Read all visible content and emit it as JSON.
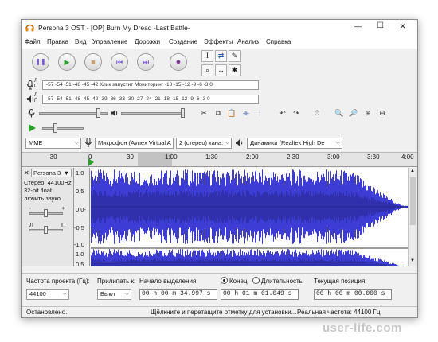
{
  "window": {
    "title": "Persona 3 OST - [OP] Burn My Dread -Last Battle-",
    "controls": {
      "minimize": "—",
      "maximize": "☐",
      "close": "✕"
    }
  },
  "menu": [
    "Файл",
    "Правка",
    "Вид",
    "Управление",
    "Дорожки",
    "Создание",
    "Эффекты",
    "Анализ",
    "Справка"
  ],
  "transport": {
    "pause": "❚❚",
    "play": "▶",
    "stop": "■",
    "skip_start": "⏮",
    "skip_end": "⏭",
    "record": "●"
  },
  "tools": {
    "selection": "I",
    "envelope": "⇄",
    "draw": "✎",
    "zoom": "⌕",
    "timeshift": "↔",
    "multi": "✱"
  },
  "meters": {
    "record_meter": "-57 -54 -51 -48 -45 -42  Клик запустит Мониторинг  -18 -15 -12  -9  -6  -3  0",
    "play_meter": "-57 -54 -51 -48 -45 -42 -39 -36 -33 -30 -27 -24 -21 -18 -15 -12  -9  -6  -3  0",
    "record_channels": "Л\nП",
    "play_channels": "Л\nП"
  },
  "devices": {
    "host": "MME",
    "input": "Микрофон (Avnex Virtual A",
    "channels": "2 (стерео) кана.",
    "output": "Динамики (Realtek High De"
  },
  "ruler": {
    "ticks": [
      "-30",
      "0",
      "30",
      "1:00",
      "1:30",
      "2:00",
      "2:30",
      "3:00",
      "3:30",
      "4:00"
    ]
  },
  "track": {
    "name": "Persona 3",
    "info1": "Стерео, 44100Hz",
    "info2": "32-bit float",
    "mute_solo": "лючить звуко",
    "gain_minus": "-",
    "gain_plus": "+",
    "pan_l": "Л",
    "pan_r": "П",
    "scale_top": [
      "1,0",
      "0,5",
      "0,0-",
      "-0,5",
      "-1,0"
    ],
    "scale_bottom": [
      "1,0",
      "0,5"
    ]
  },
  "selection_bar": {
    "project_rate_label": "Частота проекта (Гц):",
    "project_rate": "44100",
    "snap_label": "Прилипать к:",
    "snap_value": "Выкл",
    "start_label": "Начало выделения:",
    "end_option": "Конец",
    "length_option": "Длительность",
    "start_time": "00 h 00 m 34.997 s",
    "end_time": "00 h 01 m 01.049 s",
    "position_label": "Текущая позиция:",
    "position_time": "00 h 00 m 00.000 s"
  },
  "status": {
    "state": "Остановлено.",
    "hint": "Щёлкните и перетащите отметку для установки...",
    "rate": "Реальная частота: 44100 Гц"
  },
  "watermark": "user-life.com",
  "colors": {
    "waveform": "#3d3dd6",
    "waveform_dark": "#26268a",
    "selection_bg": "#bcbcbc",
    "play_green": "#2aa02a",
    "record_red": "#c02020",
    "transport_purple": "#7a5bd0"
  }
}
